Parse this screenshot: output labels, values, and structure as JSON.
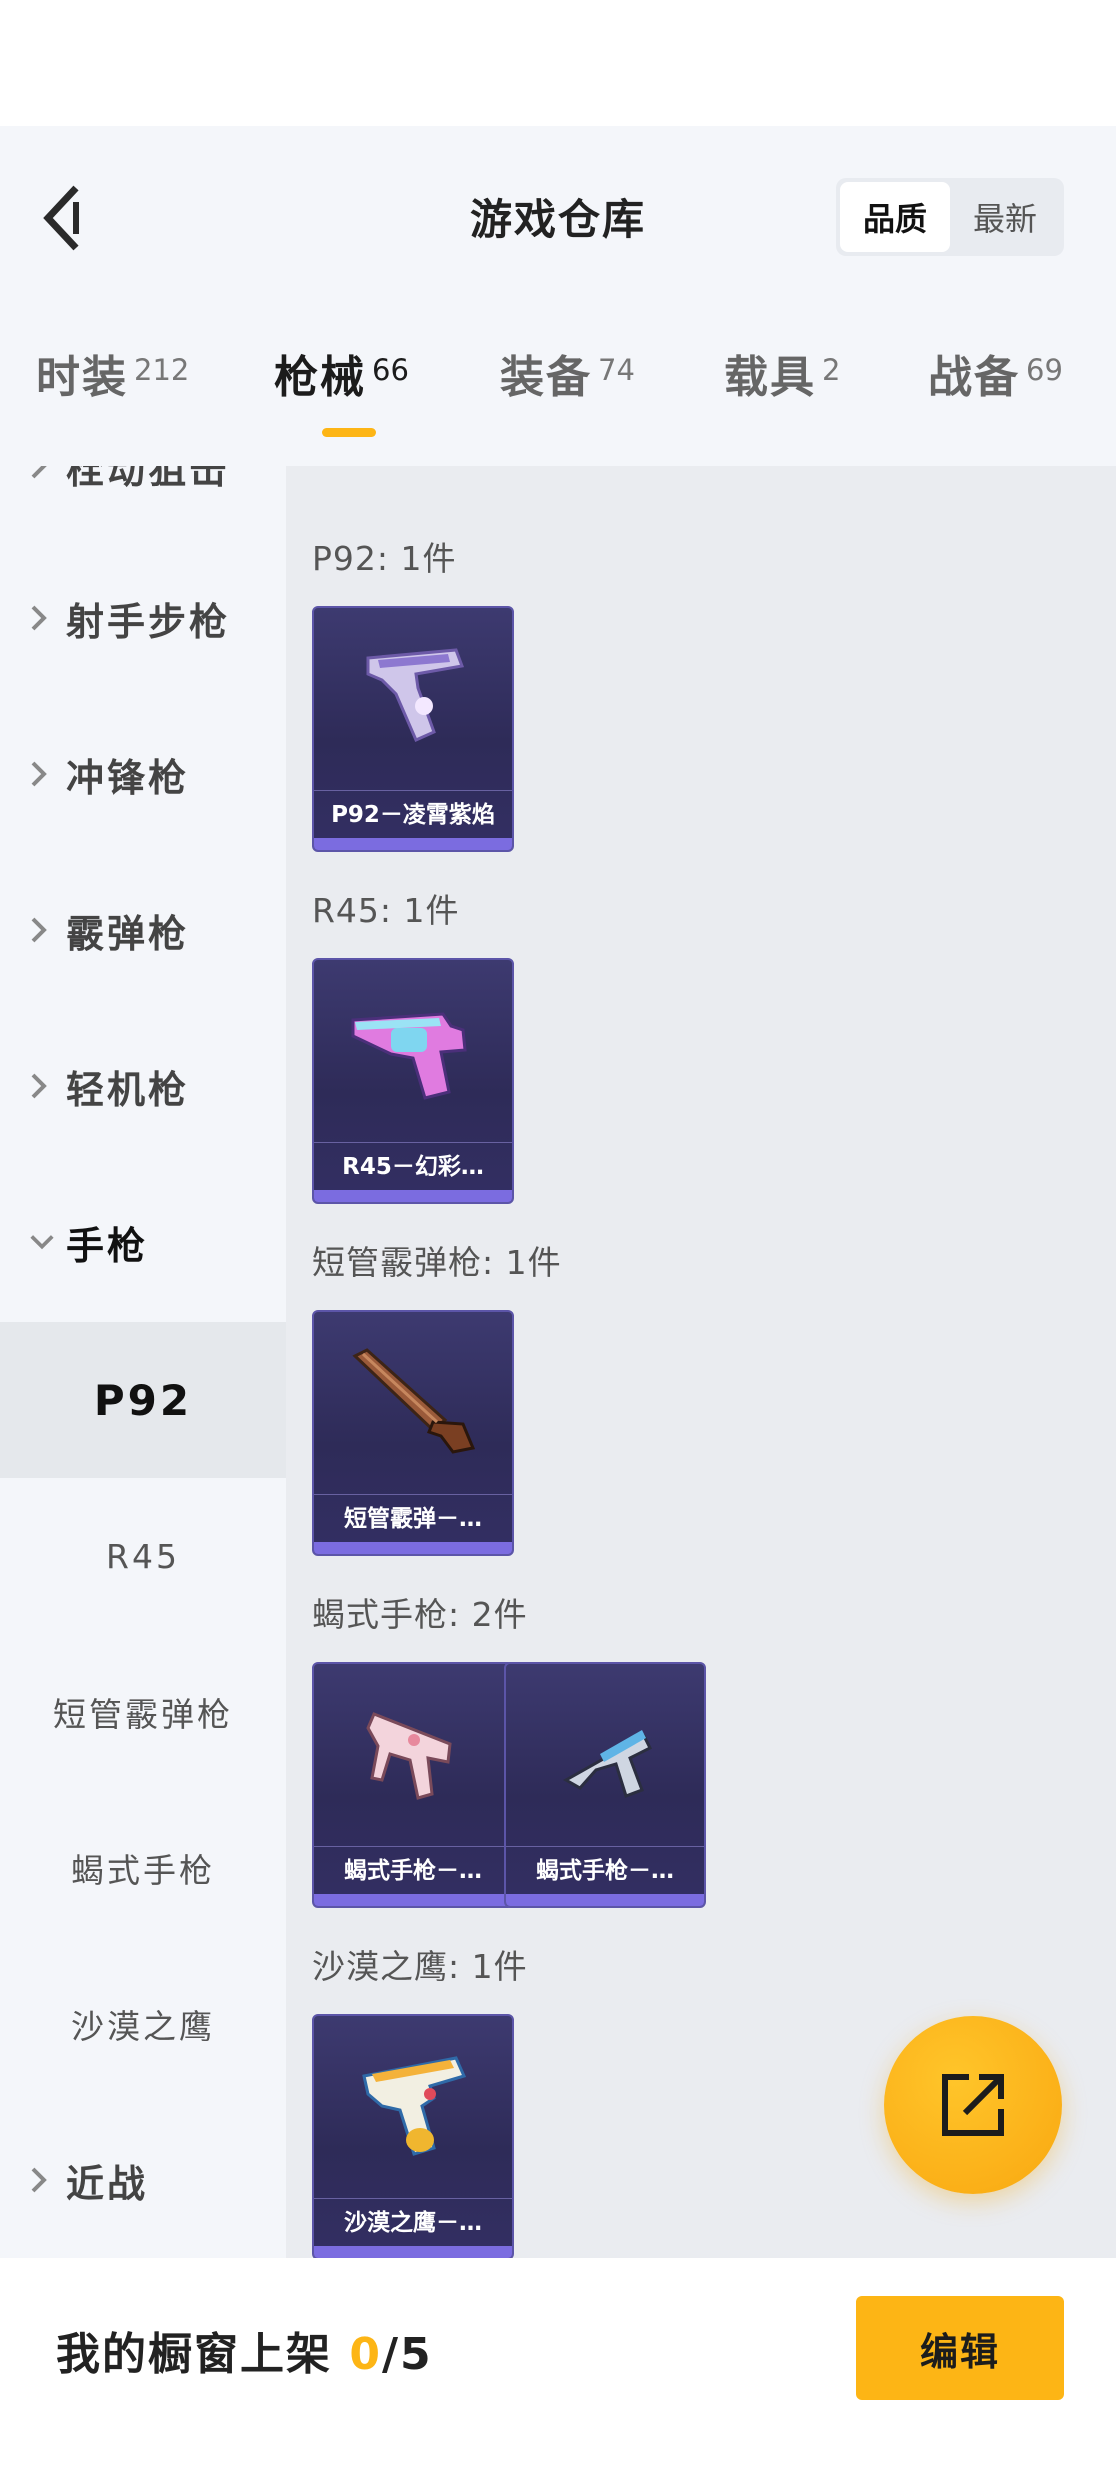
{
  "header": {
    "title": "游戏仓库",
    "sort_options": [
      "品质",
      "最新"
    ],
    "sort_selected": "品质"
  },
  "tabs": [
    {
      "label": "时装",
      "count": "212"
    },
    {
      "label": "枪械",
      "count": "66",
      "active": true
    },
    {
      "label": "装备",
      "count": "74"
    },
    {
      "label": "载具",
      "count": "2"
    },
    {
      "label": "战备",
      "count": "69"
    }
  ],
  "sidebar": {
    "partial_top": "栓动狙击",
    "categories": [
      {
        "label": "射手步枪",
        "icon": "chevron-right-icon"
      },
      {
        "label": "冲锋枪",
        "icon": "chevron-right-icon"
      },
      {
        "label": "霰弹枪",
        "icon": "chevron-right-icon"
      },
      {
        "label": "轻机枪",
        "icon": "chevron-right-icon"
      },
      {
        "label": "手枪",
        "icon": "chevron-down-icon",
        "open": true
      }
    ],
    "sub_items": [
      {
        "label": "P92",
        "active": true
      },
      {
        "label": "R45"
      },
      {
        "label": "短管霰弹枪"
      },
      {
        "label": "蝎式手枪"
      },
      {
        "label": "沙漠之鹰"
      }
    ],
    "last_category": {
      "label": "近战",
      "icon": "chevron-right-icon"
    }
  },
  "groups": [
    {
      "title": "P92: 1件",
      "items": [
        {
          "name": "P92－凌霄紫焰",
          "art": "purple-pistol"
        }
      ]
    },
    {
      "title": "R45: 1件",
      "items": [
        {
          "name": "R45－幻彩…",
          "art": "neon-revolver"
        }
      ]
    },
    {
      "title": "短管霰弹枪: 1件",
      "items": [
        {
          "name": "短管霰弹－…",
          "art": "wooden-shotgun"
        }
      ]
    },
    {
      "title": "蝎式手枪: 2件",
      "items": [
        {
          "name": "蝎式手枪－…",
          "art": "pink-smg"
        },
        {
          "name": "蝎式手枪－…",
          "art": "chrome-smg"
        }
      ]
    },
    {
      "title": "沙漠之鹰: 1件",
      "items": [
        {
          "name": "沙漠之鹰－…",
          "art": "toy-deagle"
        }
      ]
    }
  ],
  "fab": {
    "icon": "share-external-icon"
  },
  "bottom": {
    "showcase_label": "我的橱窗上架",
    "showcase_current": "0",
    "showcase_total": "/5",
    "edit_label": "编辑"
  },
  "colors": {
    "accent": "#fdb515",
    "card_bg": "#2e2b58",
    "card_border": "#5c55a8"
  }
}
